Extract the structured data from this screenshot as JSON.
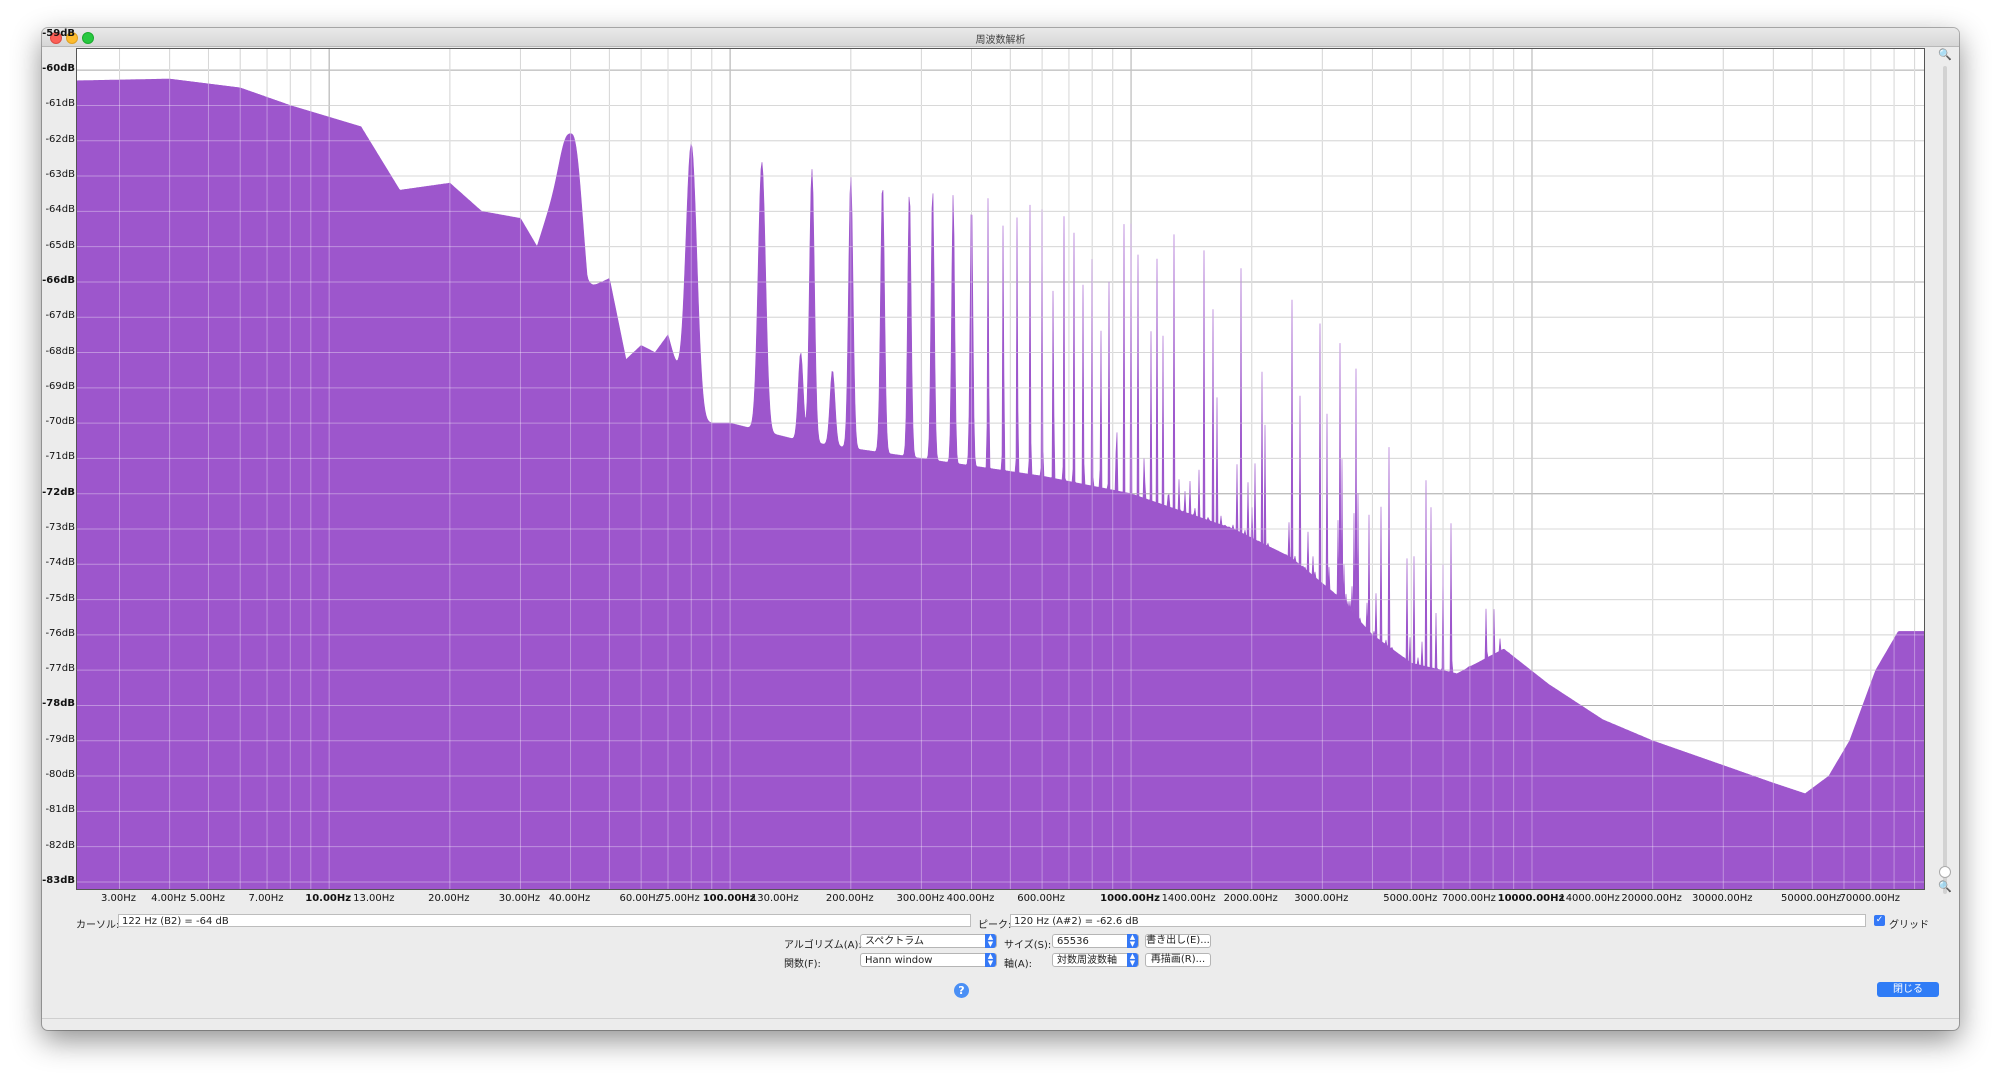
{
  "window": {
    "title": "周波数解析"
  },
  "plot": {
    "fill_color": "#9d56cc",
    "grid_color": "#c4c4c4",
    "y_labels": [
      {
        "text": "-59dB",
        "db": -59,
        "major": true
      },
      {
        "text": "-60dB",
        "db": -60,
        "major": true
      },
      {
        "text": "-61dB",
        "db": -61,
        "major": false
      },
      {
        "text": "-62dB",
        "db": -62,
        "major": false
      },
      {
        "text": "-63dB",
        "db": -63,
        "major": false
      },
      {
        "text": "-64dB",
        "db": -64,
        "major": false
      },
      {
        "text": "-65dB",
        "db": -65,
        "major": false
      },
      {
        "text": "-66dB",
        "db": -66,
        "major": true
      },
      {
        "text": "-67dB",
        "db": -67,
        "major": false
      },
      {
        "text": "-68dB",
        "db": -68,
        "major": false
      },
      {
        "text": "-69dB",
        "db": -69,
        "major": false
      },
      {
        "text": "-70dB",
        "db": -70,
        "major": false
      },
      {
        "text": "-71dB",
        "db": -71,
        "major": false
      },
      {
        "text": "-72dB",
        "db": -72,
        "major": true
      },
      {
        "text": "-73dB",
        "db": -73,
        "major": false
      },
      {
        "text": "-74dB",
        "db": -74,
        "major": false
      },
      {
        "text": "-75dB",
        "db": -75,
        "major": false
      },
      {
        "text": "-76dB",
        "db": -76,
        "major": false
      },
      {
        "text": "-77dB",
        "db": -77,
        "major": false
      },
      {
        "text": "-78dB",
        "db": -78,
        "major": true
      },
      {
        "text": "-79dB",
        "db": -79,
        "major": false
      },
      {
        "text": "-80dB",
        "db": -80,
        "major": false
      },
      {
        "text": "-81dB",
        "db": -81,
        "major": false
      },
      {
        "text": "-82dB",
        "db": -82,
        "major": false
      },
      {
        "text": "-83dB",
        "db": -83,
        "major": true
      }
    ],
    "x_labels": [
      {
        "text": "3.00Hz",
        "hz": 3,
        "major": false
      },
      {
        "text": "4.00Hz",
        "hz": 4,
        "major": false
      },
      {
        "text": "5.00Hz",
        "hz": 5,
        "major": false
      },
      {
        "text": "7.00Hz",
        "hz": 7,
        "major": false
      },
      {
        "text": "10.00Hz",
        "hz": 10,
        "major": true
      },
      {
        "text": "13.00Hz",
        "hz": 13,
        "major": false
      },
      {
        "text": "20.00Hz",
        "hz": 20,
        "major": false
      },
      {
        "text": "30.00Hz",
        "hz": 30,
        "major": false
      },
      {
        "text": "40.00Hz",
        "hz": 40,
        "major": false
      },
      {
        "text": "60.00Hz",
        "hz": 60,
        "major": false
      },
      {
        "text": "75.00Hz",
        "hz": 75,
        "major": false
      },
      {
        "text": "100.00Hz",
        "hz": 100,
        "major": true
      },
      {
        "text": "130.00Hz",
        "hz": 130,
        "major": false
      },
      {
        "text": "200.00Hz",
        "hz": 200,
        "major": false
      },
      {
        "text": "300.00Hz",
        "hz": 300,
        "major": false
      },
      {
        "text": "400.00Hz",
        "hz": 400,
        "major": false
      },
      {
        "text": "600.00Hz",
        "hz": 600,
        "major": false
      },
      {
        "text": "1000.00Hz",
        "hz": 1000,
        "major": true
      },
      {
        "text": "1400.00Hz",
        "hz": 1400,
        "major": false
      },
      {
        "text": "2000.00Hz",
        "hz": 2000,
        "major": false
      },
      {
        "text": "3000.00Hz",
        "hz": 3000,
        "major": false
      },
      {
        "text": "5000.00Hz",
        "hz": 5000,
        "major": false
      },
      {
        "text": "7000.00Hz",
        "hz": 7000,
        "major": false
      },
      {
        "text": "10000.00Hz",
        "hz": 10000,
        "major": true
      },
      {
        "text": "14000.00Hz",
        "hz": 14000,
        "major": false
      },
      {
        "text": "20000.00Hz",
        "hz": 20000,
        "major": false
      },
      {
        "text": "30000.00Hz",
        "hz": 30000,
        "major": false
      },
      {
        "text": "50000.00Hz",
        "hz": 50000,
        "major": false
      },
      {
        "text": "70000.00Hz",
        "hz": 70000,
        "major": false
      }
    ]
  },
  "status": {
    "cursor_label": "カーソル:",
    "cursor_value": "122 Hz (B2) = -64 dB",
    "peak_label": "ピーク:",
    "peak_value": "120 Hz (A#2) = -62.6 dB",
    "grid_label": "グリッド",
    "grid_checked": true
  },
  "controls": {
    "algorithm_label": "アルゴリズム(A):",
    "algorithm_value": "スペクトラム",
    "size_label": "サイズ(S):",
    "size_value": "65536",
    "export_button": "書き出し(E)...",
    "function_label": "関数(F):",
    "function_value": "Hann window",
    "axis_label": "軸(A):",
    "axis_value": "対数周波数軸",
    "replot_button": "再描画(R)...",
    "help_glyph": "?",
    "close_button": "閉じる"
  }
}
